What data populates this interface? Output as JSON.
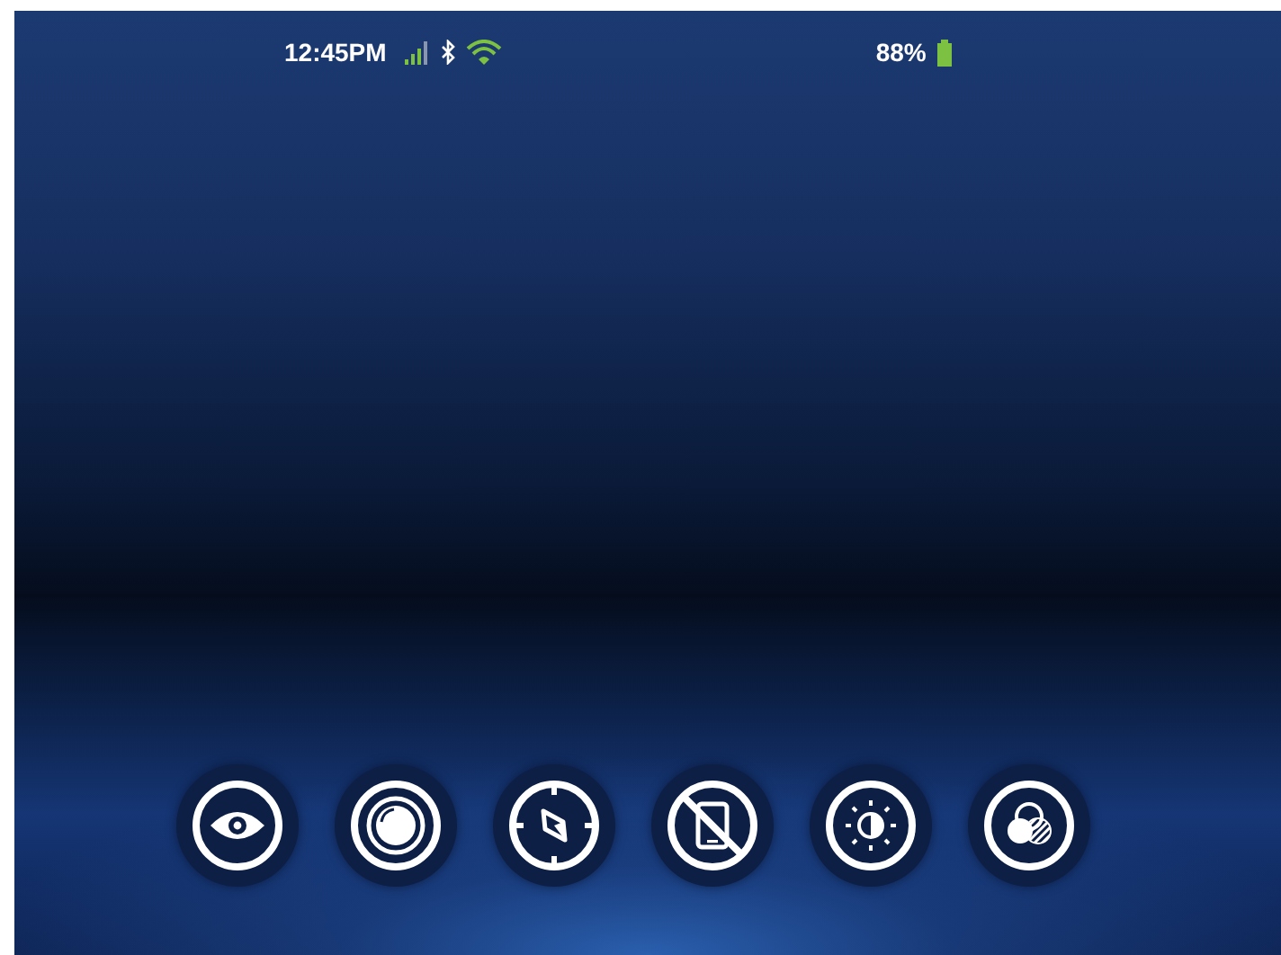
{
  "status_bar": {
    "time": "12:45PM",
    "battery": "88%"
  }
}
